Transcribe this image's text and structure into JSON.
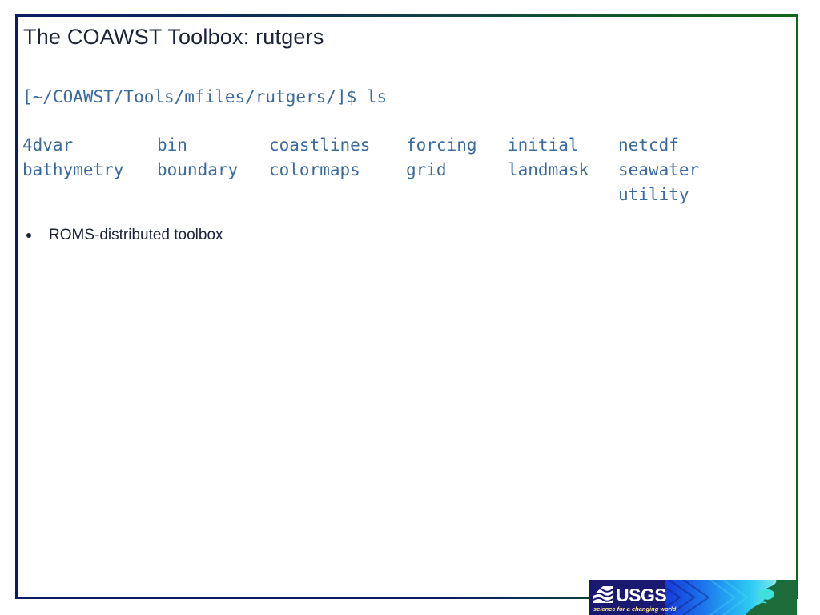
{
  "slide": {
    "title": "The COAWST Toolbox: rutgers",
    "border_color_left": "#0b1c63",
    "border_color_right": "#15661a",
    "background": "#ffffff"
  },
  "terminal": {
    "prompt_line": "[~/COAWST/Tools/mfiles/rutgers/]$ ls",
    "prompt_path": "[~/COAWST/Tools/mfiles/rutgers/]$",
    "command": "ls",
    "text_color": "#3a6a9e",
    "listing_columns": [
      {
        "entries": [
          "4dvar",
          "bathymetry"
        ]
      },
      {
        "entries": [
          "bin",
          "boundary"
        ]
      },
      {
        "entries": [
          "coastlines",
          "colormaps"
        ]
      },
      {
        "entries": [
          "forcing",
          "grid"
        ]
      },
      {
        "entries": [
          "initial",
          "landmask"
        ]
      },
      {
        "entries": [
          "netcdf",
          "seawater",
          "utility"
        ]
      }
    ]
  },
  "bullets": [
    {
      "label": "ROMS-distributed toolbox"
    }
  ],
  "logo": {
    "name": "usgs-logo",
    "wordmark": "USGS",
    "tagline": "science for a changing world",
    "panel_color": "#191970",
    "tagline_color": "#ffe88c",
    "land_color": "#1d6b38"
  }
}
